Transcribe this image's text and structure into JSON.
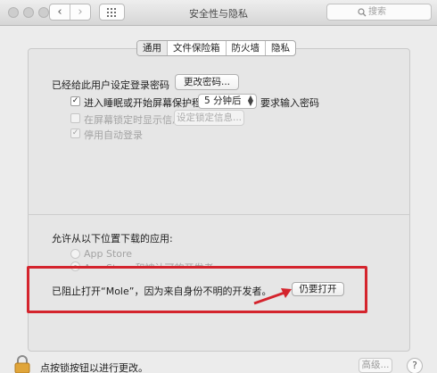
{
  "window": {
    "title": "安全性与隐私"
  },
  "toolbar": {
    "back_label": "‹",
    "forward_label": "›",
    "search_placeholder": "搜索"
  },
  "tabs": [
    {
      "label": "通用",
      "active": true
    },
    {
      "label": "文件保险箱",
      "active": false
    },
    {
      "label": "防火墙",
      "active": false
    },
    {
      "label": "隐私",
      "active": false
    }
  ],
  "general": {
    "password_set_label": "已经给此用户设定登录密码",
    "change_password_button": "更改密码...",
    "require_password": {
      "checked": true,
      "check_mark": "✓",
      "label": "进入睡眠或开始屏幕保护程序",
      "delay_value": "5 分钟后",
      "suffix": "要求输入密码"
    },
    "show_message": {
      "checked": false,
      "label": "在屏幕锁定时显示信息",
      "button": "设定锁定信息..."
    },
    "disable_auto_login": {
      "checked": true,
      "check_mark": "✓",
      "label": "停用自动登录"
    }
  },
  "downloads": {
    "heading": "允许从以下位置下载的应用:",
    "options": [
      {
        "label": "App Store",
        "selected": false
      },
      {
        "label": "App Store 和被认可的开发者",
        "selected": true
      }
    ],
    "blocked_message": "已阻止打开“Mole”，因为来自身份不明的开发者。",
    "open_anyway_button": "仍要打开"
  },
  "footer": {
    "lock_message": "点按锁按钮以进行更改。",
    "advanced_button": "高级...",
    "help_button": "?"
  },
  "colors": {
    "highlight": "#d4242d",
    "lock_body": "#e0a53a"
  },
  "icons": {
    "lock": "lock-icon",
    "search": "search-icon",
    "grid": "grid-icon",
    "arrow": "red-arrow-icon"
  }
}
